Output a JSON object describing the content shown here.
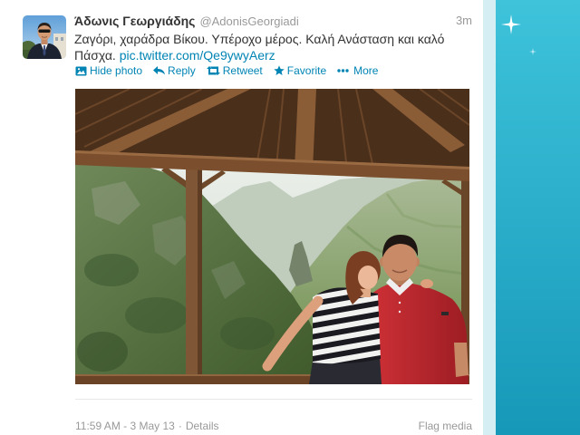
{
  "theme": {
    "accent_color": "#0084b4",
    "text_color": "#333333",
    "meta_color": "#999999",
    "panel_color": "#ffffff",
    "background_top": "#3ec3db",
    "background_bottom": "#1698b8"
  },
  "tweet": {
    "user": {
      "name": "Άδωνις Γεωργιάδης",
      "handle": "@AdonisGeorgiadi",
      "avatar_icon": "avatar-photo"
    },
    "time_ago": "3m",
    "text": "Ζαγόρι, χαράδρα Βίκου. Υπέροχο μέρος. Καλή Ανάσταση και καλό Πάσχα.",
    "link": "pic.twitter.com/Qe9ywyAerz",
    "actions": [
      {
        "label": "Hide photo",
        "icon": "photo-icon"
      },
      {
        "label": "Reply",
        "icon": "reply-icon"
      },
      {
        "label": "Retweet",
        "icon": "retweet-icon"
      },
      {
        "label": "Favorite",
        "icon": "star-icon"
      },
      {
        "label": "More",
        "icon": "more-dots-icon"
      }
    ]
  },
  "footer": {
    "timestamp": "11:59 AM - 3 May 13",
    "separator": "·",
    "details": "Details",
    "flag_media": "Flag media"
  }
}
